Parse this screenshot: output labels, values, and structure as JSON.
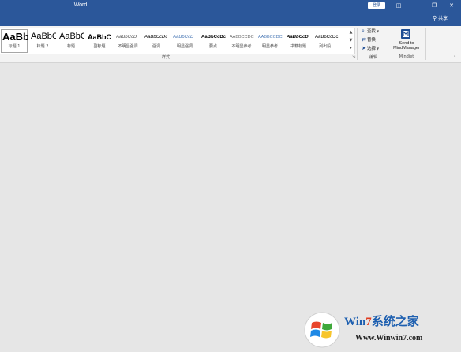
{
  "titlebar": {
    "app_title": "Word",
    "signin_label": "登录",
    "share_label": "共享",
    "controls": [
      "ribbon-display-icon",
      "minimize-icon",
      "restore-icon",
      "close-icon"
    ]
  },
  "styles": {
    "items": [
      {
        "preview": "AaBb",
        "label": "标题 1"
      },
      {
        "preview": "AaBbC",
        "label": "标题 2"
      },
      {
        "preview": "AaBbC",
        "label": "标题"
      },
      {
        "preview": "AaBbC",
        "label": "副标题"
      },
      {
        "preview": "AaBbCcD",
        "label": "不明显强调"
      },
      {
        "preview": "AaBbCcDc",
        "label": "强调"
      },
      {
        "preview": "AaBbCcD",
        "label": "明显强调"
      },
      {
        "preview": "AaBbCcDc",
        "label": "要点"
      },
      {
        "preview": "AABBCCDC",
        "label": "不明显参考"
      },
      {
        "preview": "AABBCCDC",
        "label": "明显参考"
      },
      {
        "preview": "AaBbCcD",
        "label": "书籍标题"
      },
      {
        "preview": "AaBbCcDc",
        "label": "列出段..."
      }
    ],
    "group_label": "样式"
  },
  "editing": {
    "find_label": "查找",
    "replace_label": "替换",
    "select_label": "选择",
    "group_label": "编辑"
  },
  "mindjet": {
    "button_line1": "Send to",
    "button_line2": "MindManager",
    "group_label": "Mindjet"
  },
  "watermark": {
    "brand_a": "Win",
    "brand_seven": "7",
    "brand_b": "系统之家",
    "url": "Www.Winwin7.com"
  },
  "colors": {
    "titlebar": "#2b579a",
    "ribbon": "#f3f3f3",
    "canvas": "#e6e6e6",
    "watermark_blue": "#1d5fb0",
    "watermark_red": "#e03a1e"
  }
}
